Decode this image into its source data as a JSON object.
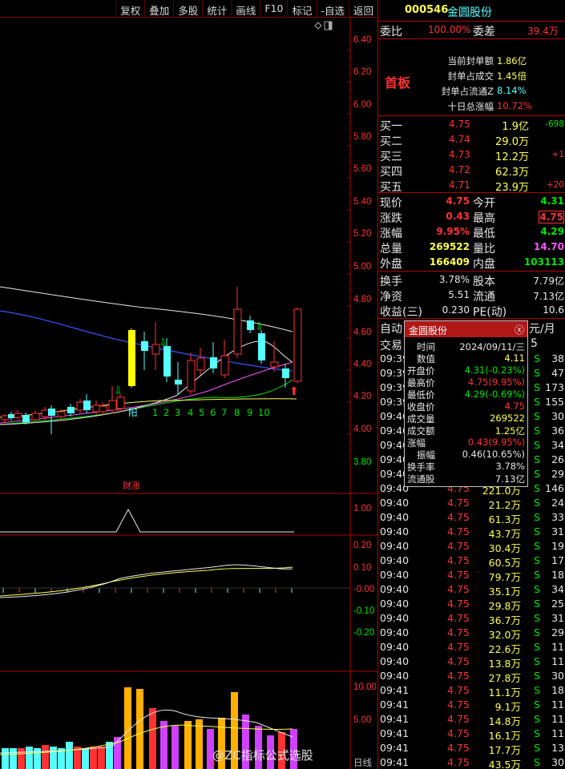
{
  "toolbar": [
    "复权",
    "叠加",
    "多股",
    "统计",
    "画线",
    "F10",
    "标记",
    "-自选",
    "返回"
  ],
  "price_axis": {
    "labels": [
      "6.40",
      "6.20",
      "6.00",
      "5.80",
      "5.60",
      "5.40",
      "5.20",
      "5.00",
      "4.80",
      "4.60",
      "4.40",
      "4.20",
      "4.00",
      "3.80"
    ],
    "ind1": [
      "1.00"
    ],
    "ind2": [
      "0.20",
      "0.10",
      "-0.00",
      "-0.10",
      "-0.20"
    ],
    "ind3": [
      "10.00",
      "5.00",
      "日线"
    ]
  },
  "chart_marks": {
    "days": [
      "阳",
      "1",
      "2",
      "3",
      "4",
      "5",
      "6",
      "7",
      "8",
      "9",
      "10"
    ],
    "caizhang": "财涨",
    "bottom_tick": "9"
  },
  "colors": {
    "up": "#ff3232",
    "down": "#54ffff",
    "accent_red": "#b00000",
    "yellow": "#ffff54",
    "green": "#00e600"
  },
  "panel": {
    "code": "000546",
    "name": "金圆股份",
    "weibi_label": "委比",
    "weibi_value": "100.00%",
    "weicha_label": "委差",
    "weicha_value": "39.4万",
    "board_label": "首板",
    "stats": [
      {
        "label": "当前封单额",
        "value": "1.86亿"
      },
      {
        "label": "封单占成交",
        "value": "1.45倍"
      },
      {
        "label": "封单占流通Z",
        "value": "8.14%"
      },
      {
        "label": "十日总涨幅",
        "value": "10.72%"
      }
    ],
    "bids": [
      {
        "label": "买一",
        "price": "4.75",
        "vol": "1.9亿",
        "chg": "-698"
      },
      {
        "label": "买二",
        "price": "4.74",
        "vol": "29.0万",
        "chg": ""
      },
      {
        "label": "买三",
        "price": "4.73",
        "vol": "12.2万",
        "chg": "+1"
      },
      {
        "label": "买四",
        "price": "4.72",
        "vol": "62.3万",
        "chg": ""
      },
      {
        "label": "买五",
        "price": "4.71",
        "vol": "23.9万",
        "chg": "+20"
      }
    ],
    "quote": [
      {
        "l1": "现价",
        "v1": "4.75",
        "l2": "今开",
        "v2": "4.31"
      },
      {
        "l1": "涨跌",
        "v1": "0.43",
        "l2": "最高",
        "v2": "4.75"
      },
      {
        "l1": "涨幅",
        "v1": "9.95%",
        "l2": "最低",
        "v2": "4.29"
      },
      {
        "l1": "总量",
        "v1": "269522",
        "l2": "量比",
        "v2": "14.70"
      },
      {
        "l1": "外盘",
        "v1": "166409",
        "l2": "内盘",
        "v2": "103113"
      }
    ],
    "fundamentals": [
      {
        "l1": "换手",
        "v1": "3.78%",
        "l2": "股本",
        "v2": "7.79亿"
      },
      {
        "l1": "净资",
        "v1": "5.51",
        "l2": "流通",
        "v2": "7.13亿"
      },
      {
        "l1": "收益(三)",
        "v1": "0.230",
        "l2": "PE(动)",
        "v2": "10.6"
      }
    ],
    "auto_label": "自动",
    "auto_suffix": "元/月",
    "trade_label": "交易",
    "trade_suffix": "5",
    "ticks_hidden": [
      {
        "time": "09:39",
        "side": "S",
        "n": "38"
      },
      {
        "time": "09:39",
        "side": "S",
        "n": "47"
      },
      {
        "time": "09:39",
        "side": "S",
        "n": "173"
      },
      {
        "time": "09:39",
        "side": "S",
        "n": "155"
      },
      {
        "time": "09:40",
        "side": "S",
        "n": "30"
      },
      {
        "time": "09:40",
        "side": "S",
        "n": "36"
      },
      {
        "time": "09:40",
        "side": "S",
        "n": "34"
      },
      {
        "time": "09:40",
        "side": "S",
        "n": "26"
      },
      {
        "time": "09:40",
        "side": "S",
        "n": "29"
      }
    ],
    "ticks": [
      {
        "time": "09:40",
        "price": "4.75",
        "vol": "221.0万",
        "side": "S",
        "n": "146"
      },
      {
        "time": "09:40",
        "price": "4.75",
        "vol": "21.2万",
        "side": "S",
        "n": "24"
      },
      {
        "time": "09:40",
        "price": "4.75",
        "vol": "61.3万",
        "side": "S",
        "n": "33"
      },
      {
        "time": "09:40",
        "price": "4.75",
        "vol": "43.7万",
        "side": "S",
        "n": "31"
      },
      {
        "time": "09:40",
        "price": "4.75",
        "vol": "30.4万",
        "side": "S",
        "n": "19"
      },
      {
        "time": "09:40",
        "price": "4.75",
        "vol": "60.5万",
        "side": "S",
        "n": "17"
      },
      {
        "time": "09:40",
        "price": "4.75",
        "vol": "79.7万",
        "side": "S",
        "n": "18"
      },
      {
        "time": "09:40",
        "price": "4.75",
        "vol": "35.1万",
        "side": "S",
        "n": "34"
      },
      {
        "time": "09:40",
        "price": "4.75",
        "vol": "29.8万",
        "side": "S",
        "n": "25"
      },
      {
        "time": "09:40",
        "price": "4.75",
        "vol": "36.7万",
        "side": "S",
        "n": "31"
      },
      {
        "time": "09:40",
        "price": "4.75",
        "vol": "32.0万",
        "side": "S",
        "n": "29"
      },
      {
        "time": "09:40",
        "price": "4.75",
        "vol": "22.6万",
        "side": "S",
        "n": "11"
      },
      {
        "time": "09:40",
        "price": "4.75",
        "vol": "13.8万",
        "side": "S",
        "n": "11"
      },
      {
        "time": "09:40",
        "price": "4.75",
        "vol": "27.8万",
        "side": "S",
        "n": "30"
      },
      {
        "time": "09:41",
        "price": "4.75",
        "vol": "11.1万",
        "side": "S",
        "n": "18"
      },
      {
        "time": "09:41",
        "price": "4.75",
        "vol": "9.1万",
        "side": "S",
        "n": "11"
      },
      {
        "time": "09:41",
        "price": "4.75",
        "vol": "14.8万",
        "side": "S",
        "n": "11"
      },
      {
        "time": "09:41",
        "price": "4.75",
        "vol": "16.1万",
        "side": "S",
        "n": "11"
      },
      {
        "time": "09:41",
        "price": "4.75",
        "vol": "17.7万",
        "side": "S",
        "n": "13"
      },
      {
        "time": "09:41",
        "price": "4.75",
        "vol": "43.5万",
        "side": "S",
        "n": "30"
      }
    ]
  },
  "popup": {
    "title": "金圆股份",
    "close": "ⓧ",
    "rows": [
      {
        "label": "时间",
        "value": "2024/09/11/三"
      },
      {
        "label": "数值",
        "value": "4.11"
      },
      {
        "label": "开盘价",
        "value": "4.31(-0.23%)"
      },
      {
        "label": "最高价",
        "value": "4.75(9.95%)"
      },
      {
        "label": "最低价",
        "value": "4.29(-0.69%)"
      },
      {
        "label": "收盘价",
        "value": "4.75"
      },
      {
        "label": "成交量",
        "value": "269522"
      },
      {
        "label": "成交额",
        "value": "1.25亿"
      },
      {
        "label": "涨幅",
        "value": "0.43(9.95%)"
      },
      {
        "label": "振幅",
        "value": "0.46(10.65%)"
      },
      {
        "label": "换手率",
        "value": "3.78%"
      },
      {
        "label": "流通股",
        "value": "7.13亿"
      }
    ]
  },
  "watermark": "@ZC指标公式选股"
}
